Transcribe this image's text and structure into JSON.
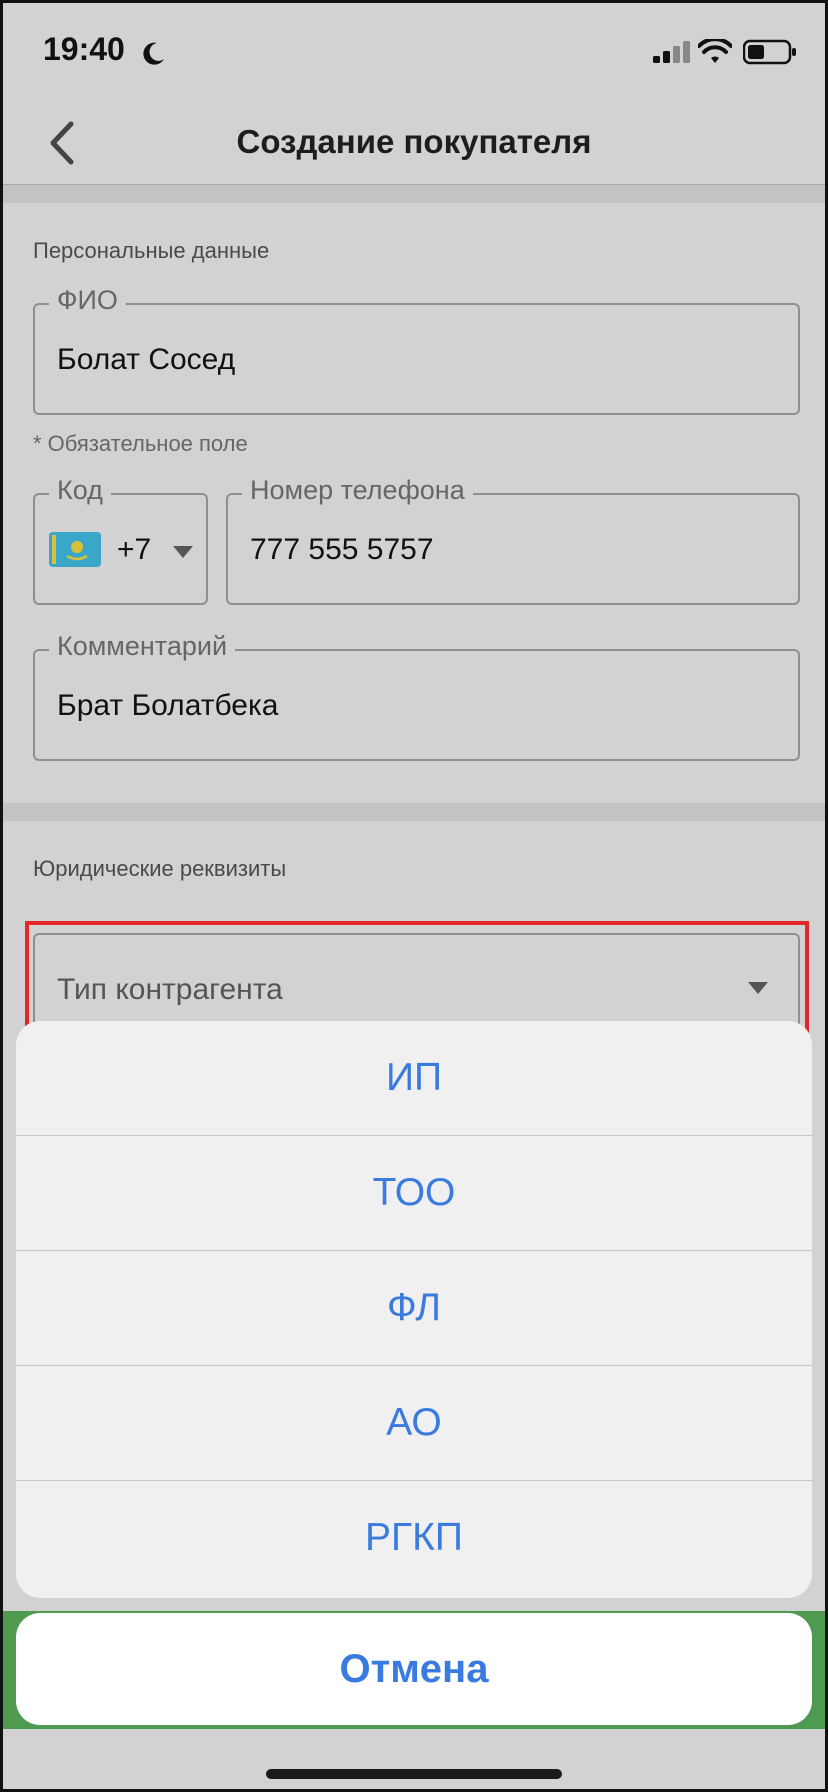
{
  "status_bar": {
    "time": "19:40"
  },
  "nav": {
    "title": "Создание покупателя"
  },
  "personal": {
    "section_title": "Персональные данные",
    "fio": {
      "label": "ФИО",
      "value": "Болат Сосед"
    },
    "required_hint": "* Обязательное поле",
    "code": {
      "label": "Код",
      "value": "+7"
    },
    "phone": {
      "label": "Номер телефона",
      "value": "777 555 5757"
    },
    "comment": {
      "label": "Комментарий",
      "value": "Брат Болатбека"
    }
  },
  "legal": {
    "section_title": "Юридические реквизиты",
    "type_field": {
      "placeholder": "Тип контрагента"
    }
  },
  "action_sheet": {
    "options": [
      "ИП",
      "ТОО",
      "ФЛ",
      "АО",
      "РГКП"
    ],
    "cancel": "Отмена"
  },
  "colors": {
    "accent": "#3a7be0",
    "highlight": "#e12727",
    "green": "#4e9a50"
  }
}
